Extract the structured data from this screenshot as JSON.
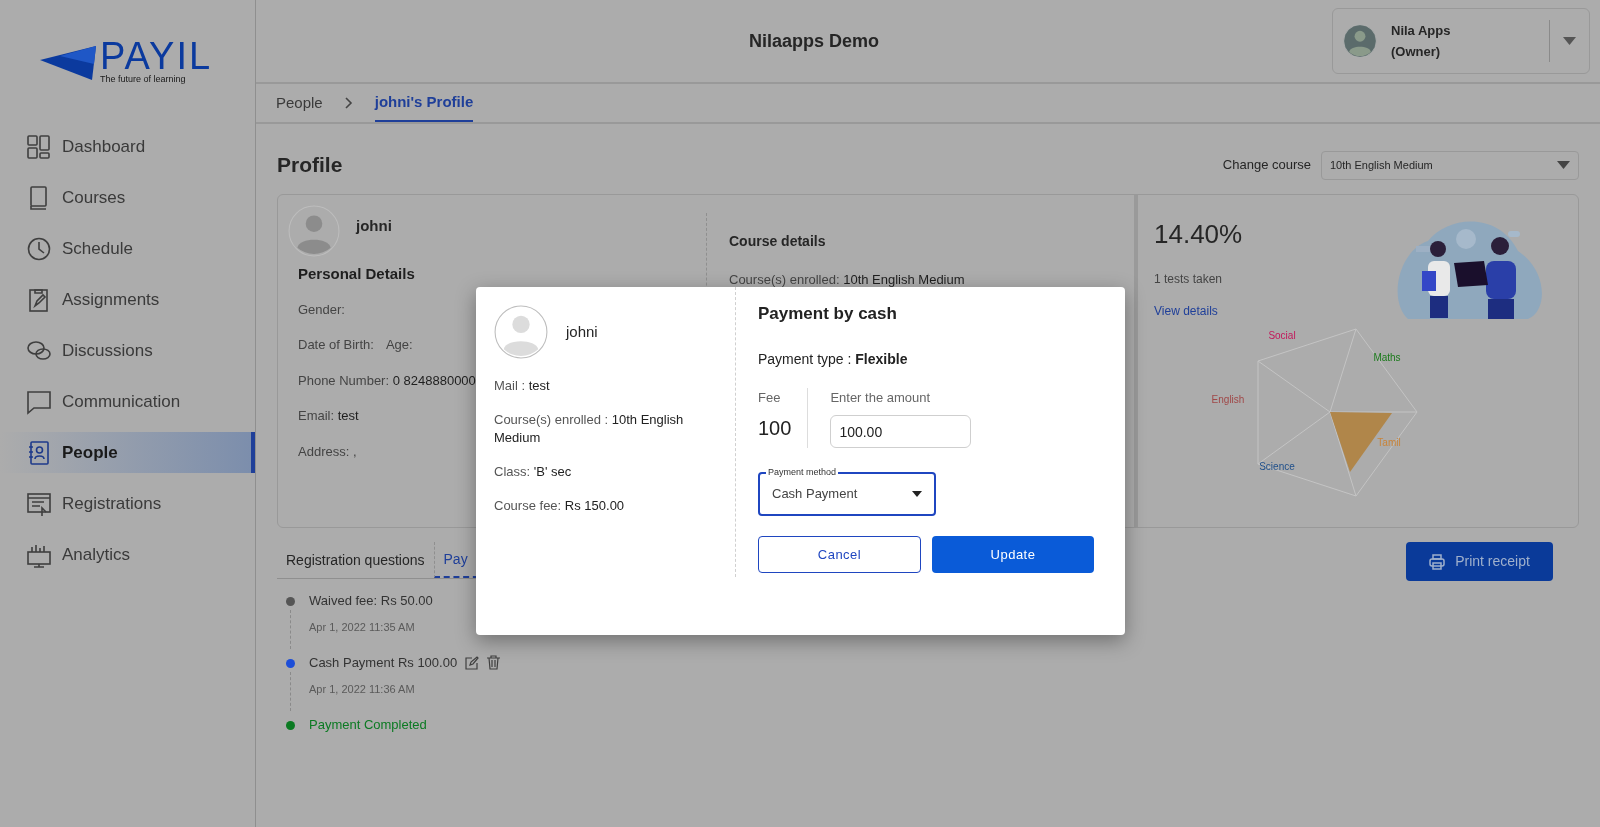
{
  "app": {
    "logo_text": "PAYIL",
    "tagline": "The future of learning",
    "title": "Nilaapps Demo"
  },
  "user": {
    "name": "Nila Apps",
    "role": "(Owner)"
  },
  "sidebar": {
    "items": [
      {
        "label": "Dashboard",
        "selected": false
      },
      {
        "label": "Courses",
        "selected": false
      },
      {
        "label": "Schedule",
        "selected": false
      },
      {
        "label": "Assignments",
        "selected": false
      },
      {
        "label": "Discussions",
        "selected": false
      },
      {
        "label": "Communication",
        "selected": false
      },
      {
        "label": "People",
        "selected": true
      },
      {
        "label": "Registrations",
        "selected": false
      },
      {
        "label": "Analytics",
        "selected": false
      }
    ]
  },
  "breadcrumb": [
    {
      "label": "People",
      "selected": false
    },
    {
      "label": "johni's Profile",
      "selected": true
    }
  ],
  "page": {
    "title": "Profile",
    "course_label": "Change course",
    "course_value": "10th English Medium"
  },
  "profile": {
    "name": "johni",
    "personal_title": "Personal Details",
    "lines": [
      [
        {
          "label": "Gender:"
        }
      ],
      [
        {
          "label": "Date of Birth:"
        },
        {
          "label": "Age:"
        }
      ],
      [
        {
          "label": "Phone Number:",
          "value": "0 8248880000"
        }
      ],
      [
        {
          "label": "Email:",
          "value": "test"
        }
      ],
      [
        {
          "label": "Address: ,"
        }
      ]
    ]
  },
  "course": {
    "title": "Course details",
    "enrolled_label": "Course(s) enrolled:",
    "enrolled_value": "10th English Medium"
  },
  "score": {
    "percent": "14.40%",
    "tests": "1 tests taken",
    "link": "View details",
    "radar_labels": [
      {
        "label": "Social",
        "color": "#c2185b"
      },
      {
        "label": "Maths",
        "color": "#1b7a1b"
      },
      {
        "label": "Tamil",
        "color": "#c8843a"
      },
      {
        "label": "Science",
        "color": "#1f4f8a"
      },
      {
        "label": "English",
        "color": "#a04848"
      }
    ]
  },
  "tabs": [
    {
      "label": "Registration questions",
      "selected": false
    },
    {
      "label": "Pay",
      "selected": true
    }
  ],
  "timeline": [
    {
      "kind": "entry",
      "label": "Waived fee:",
      "amount": "Rs 50.00",
      "time": "Apr 1, 2022 11:35 AM",
      "color": "#555555",
      "editable": false
    },
    {
      "kind": "entry",
      "label": "Cash Payment",
      "amount": "Rs 100.00",
      "time": "Apr 1, 2022 11:36 AM",
      "color": "#1d4ed8",
      "editable": true
    },
    {
      "kind": "status",
      "label": "Payment Completed",
      "color": "#0b7a22"
    }
  ],
  "print_button": "Print receipt",
  "dialog": {
    "name": "johni",
    "details": [
      {
        "label": "Mail :",
        "value": "test"
      },
      {
        "label": "Course(s) enrolled :",
        "value": "10th English Medium"
      },
      {
        "label": "Class:",
        "value": "'B' sec"
      },
      {
        "label": "Course fee:",
        "value": "Rs 150.00"
      }
    ],
    "title": "Payment by cash",
    "type_label": "Payment type :",
    "type_value": "Flexible",
    "fee_label": "Fee",
    "fee_value": "100",
    "amount_label": "Enter the amount",
    "amount_value": "100.00",
    "method_label": "Payment method",
    "method_value": "Cash Payment",
    "cancel": "Cancel",
    "update": "Update"
  }
}
